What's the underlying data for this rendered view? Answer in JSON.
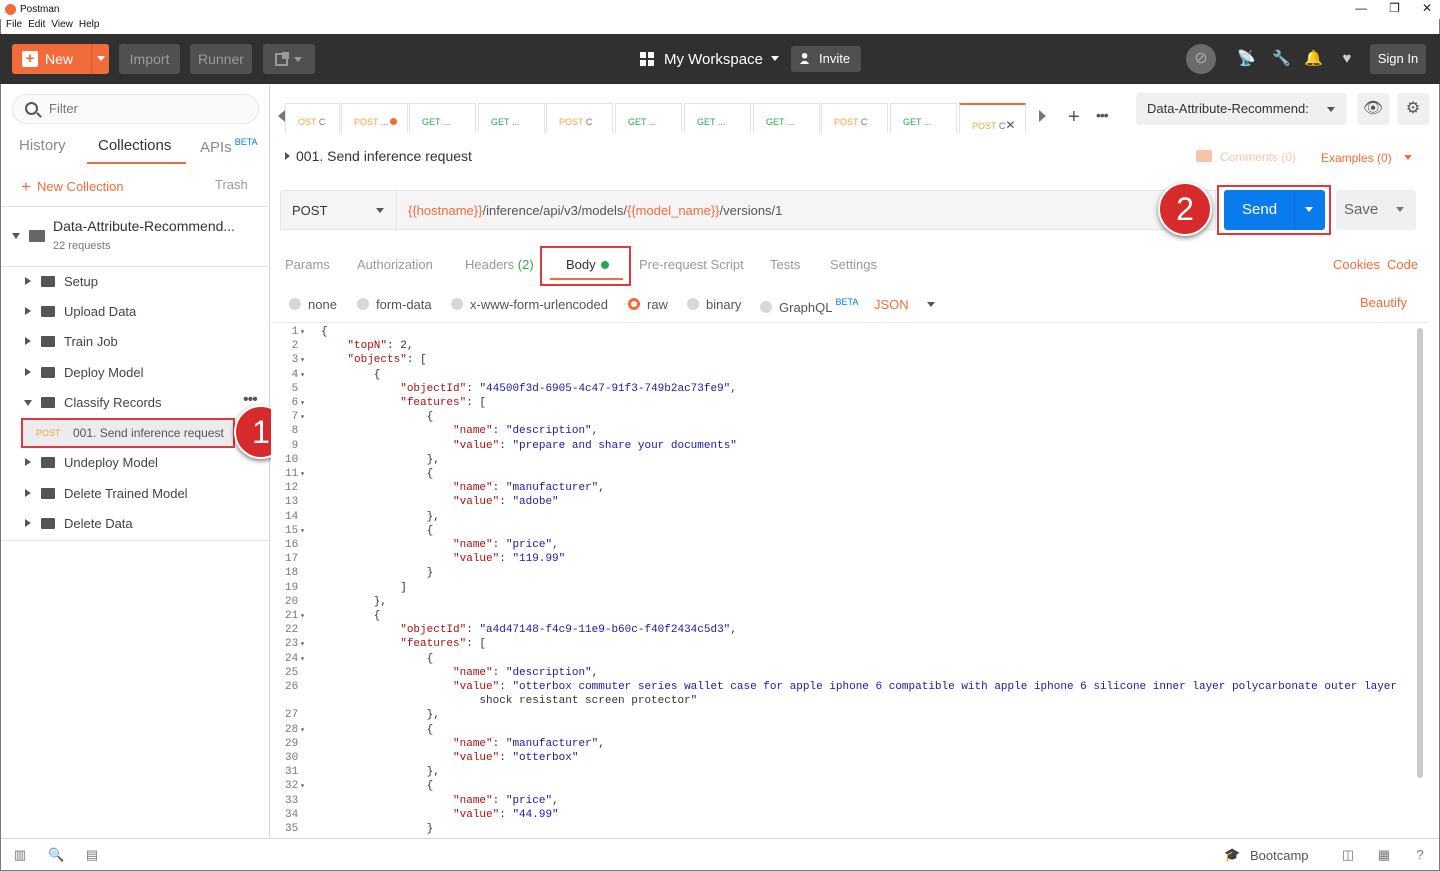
{
  "window": {
    "title": "Postman",
    "controls": [
      "—",
      "❐",
      "✕"
    ]
  },
  "menu": [
    "File",
    "Edit",
    "View",
    "Help"
  ],
  "header": {
    "new_label": "New",
    "import_label": "Import",
    "runner_label": "Runner",
    "workspace_label": "My Workspace",
    "invite_label": "Invite",
    "signin_label": "Sign In"
  },
  "sidebar": {
    "filter_placeholder": "Filter",
    "tabs": [
      "History",
      "Collections",
      "APIs"
    ],
    "apis_badge": "BETA",
    "active_tab": "Collections",
    "new_collection_label": "New Collection",
    "trash_label": "Trash",
    "collection": {
      "name": "Data-Attribute-Recommend...",
      "count": "22 requests"
    },
    "folders": [
      "Setup",
      "Upload Data",
      "Train Job",
      "Deploy Model",
      "Classify Records",
      "Undeploy Model",
      "Delete Trained Model",
      "Delete Data"
    ],
    "selected_request": {
      "method": "POST",
      "name": "001. Send inference request"
    }
  },
  "tabs": [
    {
      "method": "OST",
      "suffix": "C"
    },
    {
      "method": "POST",
      "suffix": "..."
    },
    {
      "method": "GET",
      "suffix": "..."
    },
    {
      "method": "GET",
      "suffix": "..."
    },
    {
      "method": "POST",
      "suffix": "C"
    },
    {
      "method": "GET",
      "suffix": "..."
    },
    {
      "method": "GET",
      "suffix": "..."
    },
    {
      "method": "GET",
      "suffix": "..."
    },
    {
      "method": "POST",
      "suffix": "C"
    },
    {
      "method": "GET",
      "suffix": "..."
    },
    {
      "method": "POST",
      "suffix": "C"
    }
  ],
  "environment": {
    "selected": "Data-Attribute-Recommend:"
  },
  "request": {
    "title": "001. Send inference request",
    "comments_label": "Comments (0)",
    "examples_label": "Examples (0)",
    "method": "POST",
    "url_var1": "{{hostname}}",
    "url_mid": "/inference/api/v3/models/",
    "url_var2": "{{model_name}}",
    "url_end": "/versions/1",
    "send_label": "Send",
    "save_label": "Save"
  },
  "request_tabs": {
    "params": "Params",
    "authorization": "Authorization",
    "headers": "Headers",
    "headers_count": "(2)",
    "body": "Body",
    "prerequest": "Pre-request Script",
    "tests": "Tests",
    "settings": "Settings",
    "cookies": "Cookies",
    "code": "Code"
  },
  "body_types": {
    "none": "none",
    "form_data": "form-data",
    "urlencoded": "x-www-form-urlencoded",
    "raw": "raw",
    "binary": "binary",
    "graphql": "GraphQL",
    "graphql_badge": "BETA",
    "format": "JSON",
    "beautify": "Beautify"
  },
  "callouts": [
    "1",
    "2"
  ],
  "footer": {
    "bootcamp_label": "Bootcamp"
  },
  "code_lines": [
    {
      "n": "1",
      "f": true,
      "t": "{"
    },
    {
      "n": "2",
      "f": false,
      "t": "    \"topN\": 2,"
    },
    {
      "n": "3",
      "f": true,
      "t": "    \"objects\": ["
    },
    {
      "n": "4",
      "f": true,
      "t": "        {"
    },
    {
      "n": "5",
      "f": false,
      "t": "            \"objectId\": \"44500f3d-6905-4c47-91f3-749b2ac73fe9\","
    },
    {
      "n": "6",
      "f": true,
      "t": "            \"features\": ["
    },
    {
      "n": "7",
      "f": true,
      "t": "                {"
    },
    {
      "n": "8",
      "f": false,
      "t": "                    \"name\": \"description\","
    },
    {
      "n": "9",
      "f": false,
      "t": "                    \"value\": \"prepare and share your documents\""
    },
    {
      "n": "10",
      "f": false,
      "t": "                },"
    },
    {
      "n": "11",
      "f": true,
      "t": "                {"
    },
    {
      "n": "12",
      "f": false,
      "t": "                    \"name\": \"manufacturer\","
    },
    {
      "n": "13",
      "f": false,
      "t": "                    \"value\": \"adobe\""
    },
    {
      "n": "14",
      "f": false,
      "t": "                },"
    },
    {
      "n": "15",
      "f": true,
      "t": "                {"
    },
    {
      "n": "16",
      "f": false,
      "t": "                    \"name\": \"price\","
    },
    {
      "n": "17",
      "f": false,
      "t": "                    \"value\": \"119.99\""
    },
    {
      "n": "18",
      "f": false,
      "t": "                }"
    },
    {
      "n": "19",
      "f": false,
      "t": "            ]"
    },
    {
      "n": "20",
      "f": false,
      "t": "        },"
    },
    {
      "n": "21",
      "f": true,
      "t": "        {"
    },
    {
      "n": "22",
      "f": false,
      "t": "            \"objectId\": \"a4d47148-f4c9-11e9-b60c-f40f2434c5d3\","
    },
    {
      "n": "23",
      "f": true,
      "t": "            \"features\": ["
    },
    {
      "n": "24",
      "f": true,
      "t": "                {"
    },
    {
      "n": "25",
      "f": false,
      "t": "                    \"name\": \"description\","
    },
    {
      "n": "26",
      "f": false,
      "t": "                    \"value\": \"otterbox commuter series wallet case for apple iphone 6 compatible with apple iphone 6 silicone inner layer polycarbonate outer layer"
    },
    {
      "n": "",
      "f": false,
      "t": "                        shock resistant screen protector\""
    },
    {
      "n": "27",
      "f": false,
      "t": "                },"
    },
    {
      "n": "28",
      "f": true,
      "t": "                {"
    },
    {
      "n": "29",
      "f": false,
      "t": "                    \"name\": \"manufacturer\","
    },
    {
      "n": "30",
      "f": false,
      "t": "                    \"value\": \"otterbox\""
    },
    {
      "n": "31",
      "f": false,
      "t": "                },"
    },
    {
      "n": "32",
      "f": true,
      "t": "                {"
    },
    {
      "n": "33",
      "f": false,
      "t": "                    \"name\": \"price\","
    },
    {
      "n": "34",
      "f": false,
      "t": "                    \"value\": \"44.99\""
    },
    {
      "n": "35",
      "f": false,
      "t": "                }"
    }
  ],
  "colors": {
    "accent": "#f26b3a",
    "send": "#097bed",
    "post": "#f0a541",
    "get": "#2ba54d",
    "highlight": "#e0383f"
  }
}
